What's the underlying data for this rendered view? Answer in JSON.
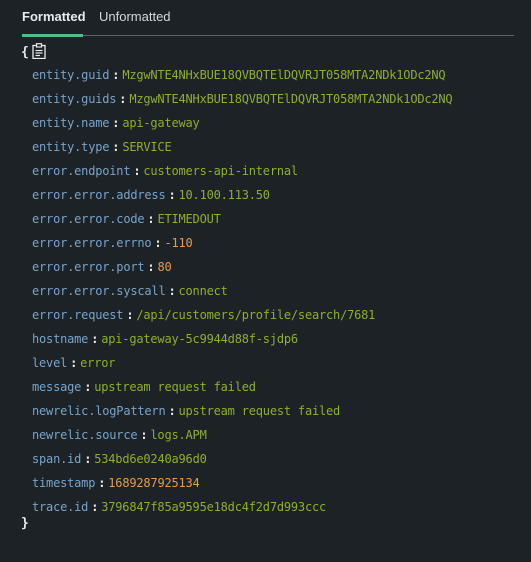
{
  "tabs": [
    {
      "label": "Formatted",
      "active": true
    },
    {
      "label": "Unformatted",
      "active": false
    }
  ],
  "json_view": {
    "open_brace": "{",
    "close_brace": "}",
    "copy_icon": "clipboard-icon",
    "colors": {
      "key": "#79a3cb",
      "string": "#8db02d",
      "number": "#e89c45",
      "accent": "#4fbf8a"
    },
    "entries": [
      {
        "key": "entity.guid",
        "value": "MzgwNTE4NHxBUE18QVBQTElDQVRJT058MTA2NDk1ODc2NQ",
        "type": "string"
      },
      {
        "key": "entity.guids",
        "value": "MzgwNTE4NHxBUE18QVBQTElDQVRJT058MTA2NDk1ODc2NQ",
        "type": "string"
      },
      {
        "key": "entity.name",
        "value": "api-gateway",
        "type": "string"
      },
      {
        "key": "entity.type",
        "value": "SERVICE",
        "type": "string"
      },
      {
        "key": "error.endpoint",
        "value": "customers-api-internal",
        "type": "string"
      },
      {
        "key": "error.error.address",
        "value": "10.100.113.50",
        "type": "string"
      },
      {
        "key": "error.error.code",
        "value": "ETIMEDOUT",
        "type": "string"
      },
      {
        "key": "error.error.errno",
        "value": "-110",
        "type": "number"
      },
      {
        "key": "error.error.port",
        "value": "80",
        "type": "number"
      },
      {
        "key": "error.error.syscall",
        "value": "connect",
        "type": "string"
      },
      {
        "key": "error.request",
        "value": "/api/customers/profile/search/7681",
        "type": "string"
      },
      {
        "key": "hostname",
        "value": "api-gateway-5c9944d88f-sjdp6",
        "type": "string"
      },
      {
        "key": "level",
        "value": "error",
        "type": "string"
      },
      {
        "key": "message",
        "value": "upstream request failed",
        "type": "string"
      },
      {
        "key": "newrelic.logPattern",
        "value": "upstream request failed",
        "type": "string"
      },
      {
        "key": "newrelic.source",
        "value": "logs.APM",
        "type": "string"
      },
      {
        "key": "span.id",
        "value": "534bd6e0240a96d0",
        "type": "string"
      },
      {
        "key": "timestamp",
        "value": "1689287925134",
        "type": "number"
      },
      {
        "key": "trace.id",
        "value": "3796847f85a9595e18dc4f2d7d993ccc",
        "type": "string"
      }
    ]
  }
}
